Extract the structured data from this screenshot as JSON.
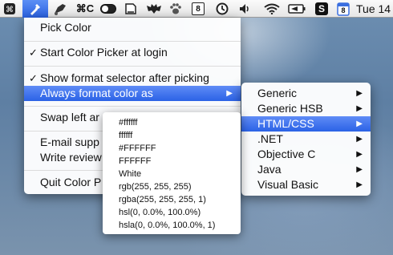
{
  "menubar": {
    "icons": [
      "command-key-icon",
      "color-picker-dropper-icon",
      "stamp-icon",
      "command-c-icon",
      "toggle-icon",
      "document-icon",
      "bat-icon",
      "paw-icon",
      "calendar-badge-icon",
      "time-machine-icon",
      "volume-icon",
      "wifi-icon",
      "battery-icon",
      "s-app-icon",
      "calendar-icon"
    ],
    "cmdc_label": "⌘C",
    "badge_number": "8",
    "s_label": "S",
    "calendar_number": "8",
    "clock": "Tue 14"
  },
  "main_menu": {
    "items": [
      {
        "label": "Pick Color",
        "checked": false
      },
      {
        "label": "Start Color Picker at login",
        "checked": true,
        "check": "✓"
      },
      {
        "label": "Show format selector after picking",
        "checked": true,
        "check": "✓"
      },
      {
        "label": "Always format color as",
        "submenu": true,
        "arrow": "▶"
      },
      {
        "label": "Swap left ar"
      },
      {
        "label": "E-mail supp"
      },
      {
        "label": "Write review"
      },
      {
        "label": "Quit Color P"
      }
    ]
  },
  "format_submenu": {
    "items": [
      {
        "label": "Generic",
        "arrow": "▶"
      },
      {
        "label": "Generic HSB",
        "arrow": "▶"
      },
      {
        "label": "HTML/CSS",
        "arrow": "▶"
      },
      {
        "label": ".NET",
        "arrow": "▶"
      },
      {
        "label": "Objective C",
        "arrow": "▶"
      },
      {
        "label": "Java",
        "arrow": "▶"
      },
      {
        "label": "Visual Basic",
        "arrow": "▶"
      }
    ]
  },
  "html_css_formats": {
    "items": [
      "#ffffff",
      "ffffff",
      "#FFFFFF",
      "FFFFFF",
      "White",
      "rgb(255, 255, 255)",
      "rgba(255, 255, 255, 1)",
      "hsl(0, 0.0%, 100.0%)",
      "hsla(0, 0.0%, 100.0%, 1)"
    ]
  }
}
